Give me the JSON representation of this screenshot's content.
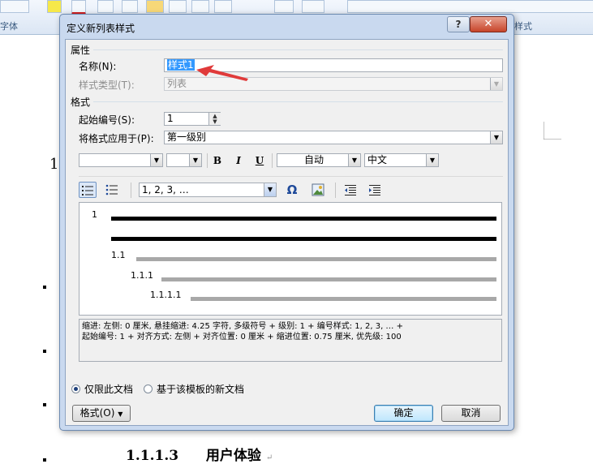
{
  "background": {
    "ribbon_label_font": "字体",
    "ribbon_label_style": "样式",
    "doc_number": "1",
    "heading_number": "1.1.1.3",
    "heading_text": "用户体验"
  },
  "dialog": {
    "title": "定义新列表样式",
    "help_label": "?",
    "close_label": "✕",
    "properties": {
      "section_label": "属性",
      "name_label": "名称(N):",
      "name_value": "样式1",
      "style_type_label": "样式类型(T):",
      "style_type_value": "列表"
    },
    "format": {
      "section_label": "格式",
      "start_at_label": "起始编号(S):",
      "start_at_value": "1",
      "apply_to_label": "将格式应用于(P):",
      "apply_to_value": "第一级别",
      "font_name_value": "",
      "font_size_value": "",
      "bold_label": "B",
      "italic_label": "I",
      "underline_label": "U",
      "color_value": "自动",
      "script_value": "中文",
      "number_style_value": "1, 2, 3, …",
      "symbol_label": "Ω"
    },
    "preview": {
      "level1": "1",
      "level2": "1.1",
      "level3": "1.1.1",
      "level4": "1.1.1.1"
    },
    "description": {
      "line1": "缩进: 左侧:  0 厘米, 悬挂缩进: 4.25 字符, 多级符号 + 级别: 1 + 编号样式: 1, 2, 3, … +",
      "line2": "起始编号: 1 + 对齐方式: 左侧 + 对齐位置:  0 厘米 + 缩进位置:  0.75 厘米, 优先级: 100"
    },
    "scope": {
      "only_this_doc": "仅限此文档",
      "new_docs_template": "基于该模板的新文档",
      "selected": "only_this_doc"
    },
    "buttons": {
      "format": "格式(O)",
      "ok": "确定",
      "cancel": "取消"
    }
  },
  "colors": {
    "annotation_arrow": "#e03a3a",
    "selection": "#3399ff"
  }
}
